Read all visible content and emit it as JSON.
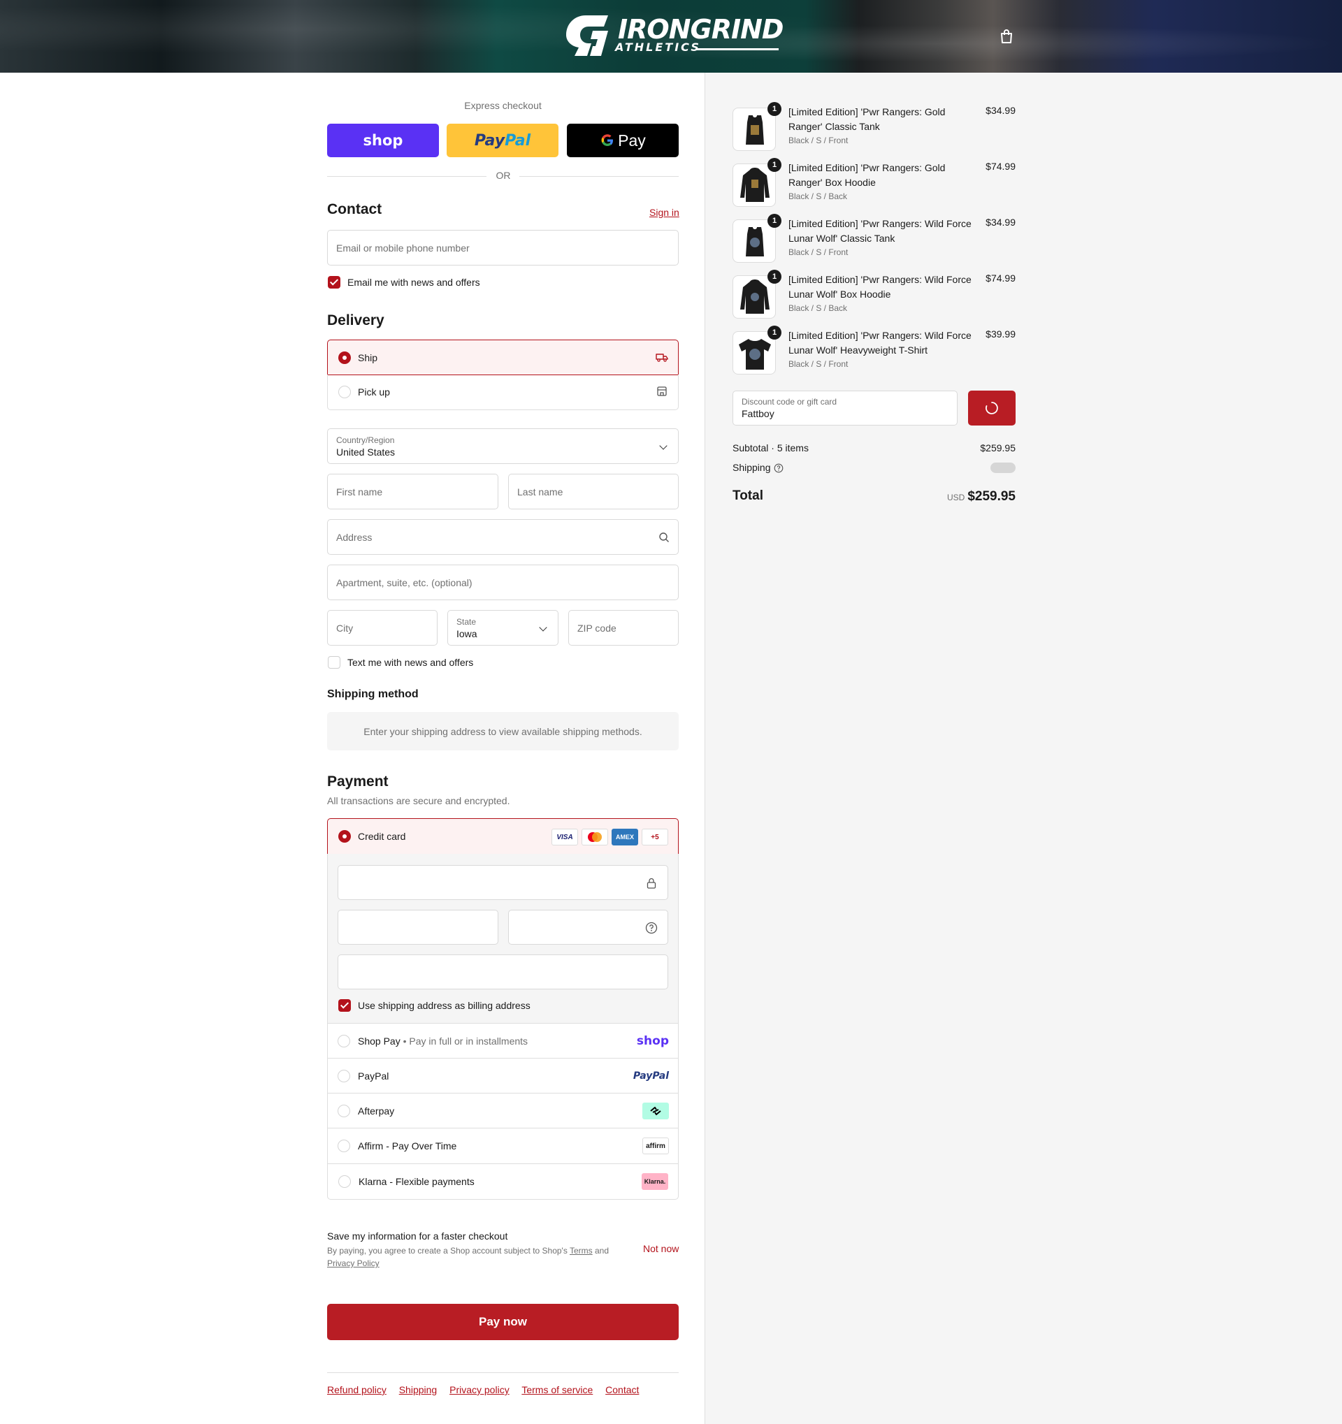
{
  "brand": {
    "name": "IRONGRIND",
    "sub": "ATHLETICS"
  },
  "express": {
    "label": "Express checkout",
    "shop_label": "shop",
    "paypal_label_a": "Pay",
    "paypal_label_b": "Pal",
    "gpay_label": "Pay",
    "or_label": "OR"
  },
  "contact": {
    "heading": "Contact",
    "signin": "Sign in",
    "email_placeholder": "Email or mobile phone number",
    "newsletter_label": "Email me with news and offers",
    "newsletter_checked": true
  },
  "delivery": {
    "heading": "Delivery",
    "options": [
      {
        "label": "Ship",
        "selected": true,
        "icon": "truck-icon"
      },
      {
        "label": "Pick up",
        "selected": false,
        "icon": "store-icon"
      }
    ],
    "country_label": "Country/Region",
    "country_value": "United States",
    "first_name_placeholder": "First name",
    "last_name_placeholder": "Last name",
    "address_placeholder": "Address",
    "apartment_placeholder": "Apartment, suite, etc. (optional)",
    "city_placeholder": "City",
    "state_label": "State",
    "state_value": "Iowa",
    "zip_placeholder": "ZIP code",
    "sms_label": "Text me with news and offers",
    "sms_checked": false
  },
  "shipping_method": {
    "heading": "Shipping method",
    "notice": "Enter your shipping address to view available shipping methods."
  },
  "payment": {
    "heading": "Payment",
    "subheading": "All transactions are secure and encrypted.",
    "credit_card_label": "Credit card",
    "card_brands": [
      "VISA",
      "mastercard",
      "AMEX",
      "+5"
    ],
    "billing_label": "Use shipping address as billing address",
    "billing_checked": true,
    "methods": [
      {
        "label": "Shop Pay",
        "note": "Pay in full or in installments",
        "logo": "shop"
      },
      {
        "label": "PayPal",
        "note": "",
        "logo": "PayPal"
      },
      {
        "label": "Afterpay",
        "note": "",
        "logo": "afterpay-icon"
      },
      {
        "label": "Affirm - Pay Over Time",
        "note": "",
        "logo": "affirm"
      },
      {
        "label": "Klarna - Flexible payments",
        "note": "",
        "logo": "Klarna."
      }
    ]
  },
  "save_info": {
    "title": "Save my information for a faster checkout",
    "legal_a": "By paying, you agree to create a Shop account subject to Shop's",
    "terms": "Terms",
    "and": "and",
    "privacy": "Privacy Policy",
    "not_now": "Not now"
  },
  "pay_button": "Pay now",
  "footer": [
    "Refund policy",
    "Shipping",
    "Privacy policy",
    "Terms of service",
    "Contact"
  ],
  "cart": {
    "items": [
      {
        "name": "[Limited Edition] 'Pwr Rangers: Gold Ranger' Classic Tank",
        "variant": "Black / S / Front",
        "price": "$34.99",
        "qty": "1"
      },
      {
        "name": "[Limited Edition] 'Pwr Rangers: Gold Ranger' Box Hoodie",
        "variant": "Black / S / Back",
        "price": "$74.99",
        "qty": "1"
      },
      {
        "name": "[Limited Edition] 'Pwr Rangers: Wild Force Lunar Wolf' Classic Tank",
        "variant": "Black / S / Front",
        "price": "$34.99",
        "qty": "1"
      },
      {
        "name": "[Limited Edition] 'Pwr Rangers: Wild Force Lunar Wolf' Box Hoodie",
        "variant": "Black / S / Back",
        "price": "$74.99",
        "qty": "1"
      },
      {
        "name": "[Limited Edition] 'Pwr Rangers: Wild Force Lunar Wolf' Heavyweight T-Shirt",
        "variant": "Black / S / Front",
        "price": "$39.99",
        "qty": "1"
      }
    ],
    "discount_label": "Discount code or gift card",
    "discount_value": "Fattboy",
    "subtotal_label": "Subtotal · 5 items",
    "subtotal_value": "$259.95",
    "shipping_label": "Shipping",
    "total_label": "Total",
    "currency": "USD",
    "total_value": "$259.95"
  },
  "colors": {
    "accent": "#b3121b",
    "shop": "#5a31f4",
    "paypal": "#ffc439",
    "gpay": "#000000"
  }
}
